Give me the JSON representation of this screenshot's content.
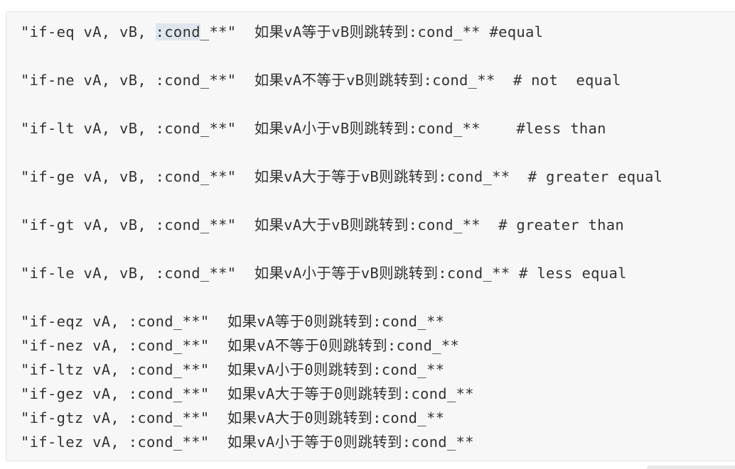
{
  "lines": [
    {
      "pre": "\"if-eq vA, vB, ",
      "hl": ":cond",
      "post": "_**\"  如果vA等于vB则跳转到:cond_** #equal"
    },
    {
      "text": "\"if-ne vA, vB, :cond_**\"  如果vA不等于vB则跳转到:cond_**  # not  equal"
    },
    {
      "text": "\"if-lt vA, vB, :cond_**\"  如果vA小于vB则跳转到:cond_**    #less than"
    },
    {
      "text": "\"if-ge vA, vB, :cond_**\"  如果vA大于等于vB则跳转到:cond_**  # greater equal"
    },
    {
      "text": "\"if-gt vA, vB, :cond_**\"  如果vA大于vB则跳转到:cond_**  # greater than"
    },
    {
      "text": "\"if-le vA, vB, :cond_**\"  如果vA小于等于vB则跳转到:cond_** # less equal"
    },
    {
      "text": "\"if-eqz vA, :cond_**\"  如果vA等于0则跳转到:cond_**"
    },
    {
      "text": "\"if-nez vA, :cond_**\"  如果vA不等于0则跳转到:cond_**"
    },
    {
      "text": "\"if-ltz vA, :cond_**\"  如果vA小于0则跳转到:cond_**"
    },
    {
      "text": "\"if-gez vA, :cond_**\"  如果vA大于等于0则跳转到:cond_**"
    },
    {
      "text": "\"if-gtz vA, :cond_**\"  如果vA大于0则跳转到:cond_**"
    },
    {
      "text": "\"if-lez vA, :cond_**\"  如果vA小于等于0则跳转到:cond_**"
    }
  ]
}
